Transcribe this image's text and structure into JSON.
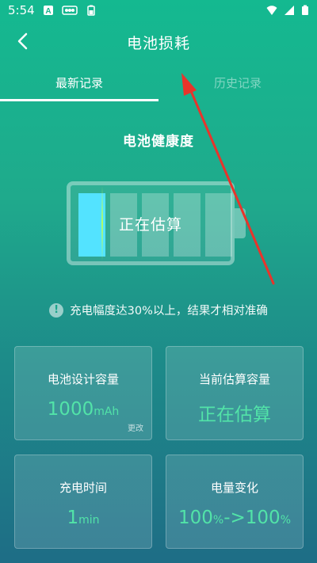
{
  "status_bar": {
    "time": "5:54"
  },
  "header": {
    "title": "电池损耗"
  },
  "tabs": [
    {
      "label": "最新记录",
      "active": true
    },
    {
      "label": "历史记录",
      "active": false
    }
  ],
  "health": {
    "title": "电池健康度",
    "battery_text": "正在估算",
    "charged_cells": 1,
    "total_cells": 5
  },
  "notice": {
    "text": "充电幅度达30%以上，结果才相对准确"
  },
  "cards": {
    "design_capacity": {
      "label": "电池设计容量",
      "value": "1000",
      "unit": "mAh",
      "edit_label": "更改"
    },
    "estimated_capacity": {
      "label": "当前估算容量",
      "value": "正在估算"
    },
    "charge_time": {
      "label": "充电时间",
      "value": "1",
      "unit": "min"
    },
    "level_change": {
      "label": "电量变化",
      "from": "100",
      "unit_from": "%",
      "arrow": "->",
      "to": "100",
      "unit_to": "%"
    }
  },
  "colors": {
    "accent_value": "#52e3a8",
    "charged_cell": "#53e3ff",
    "annotation_arrow": "#e8342b"
  }
}
